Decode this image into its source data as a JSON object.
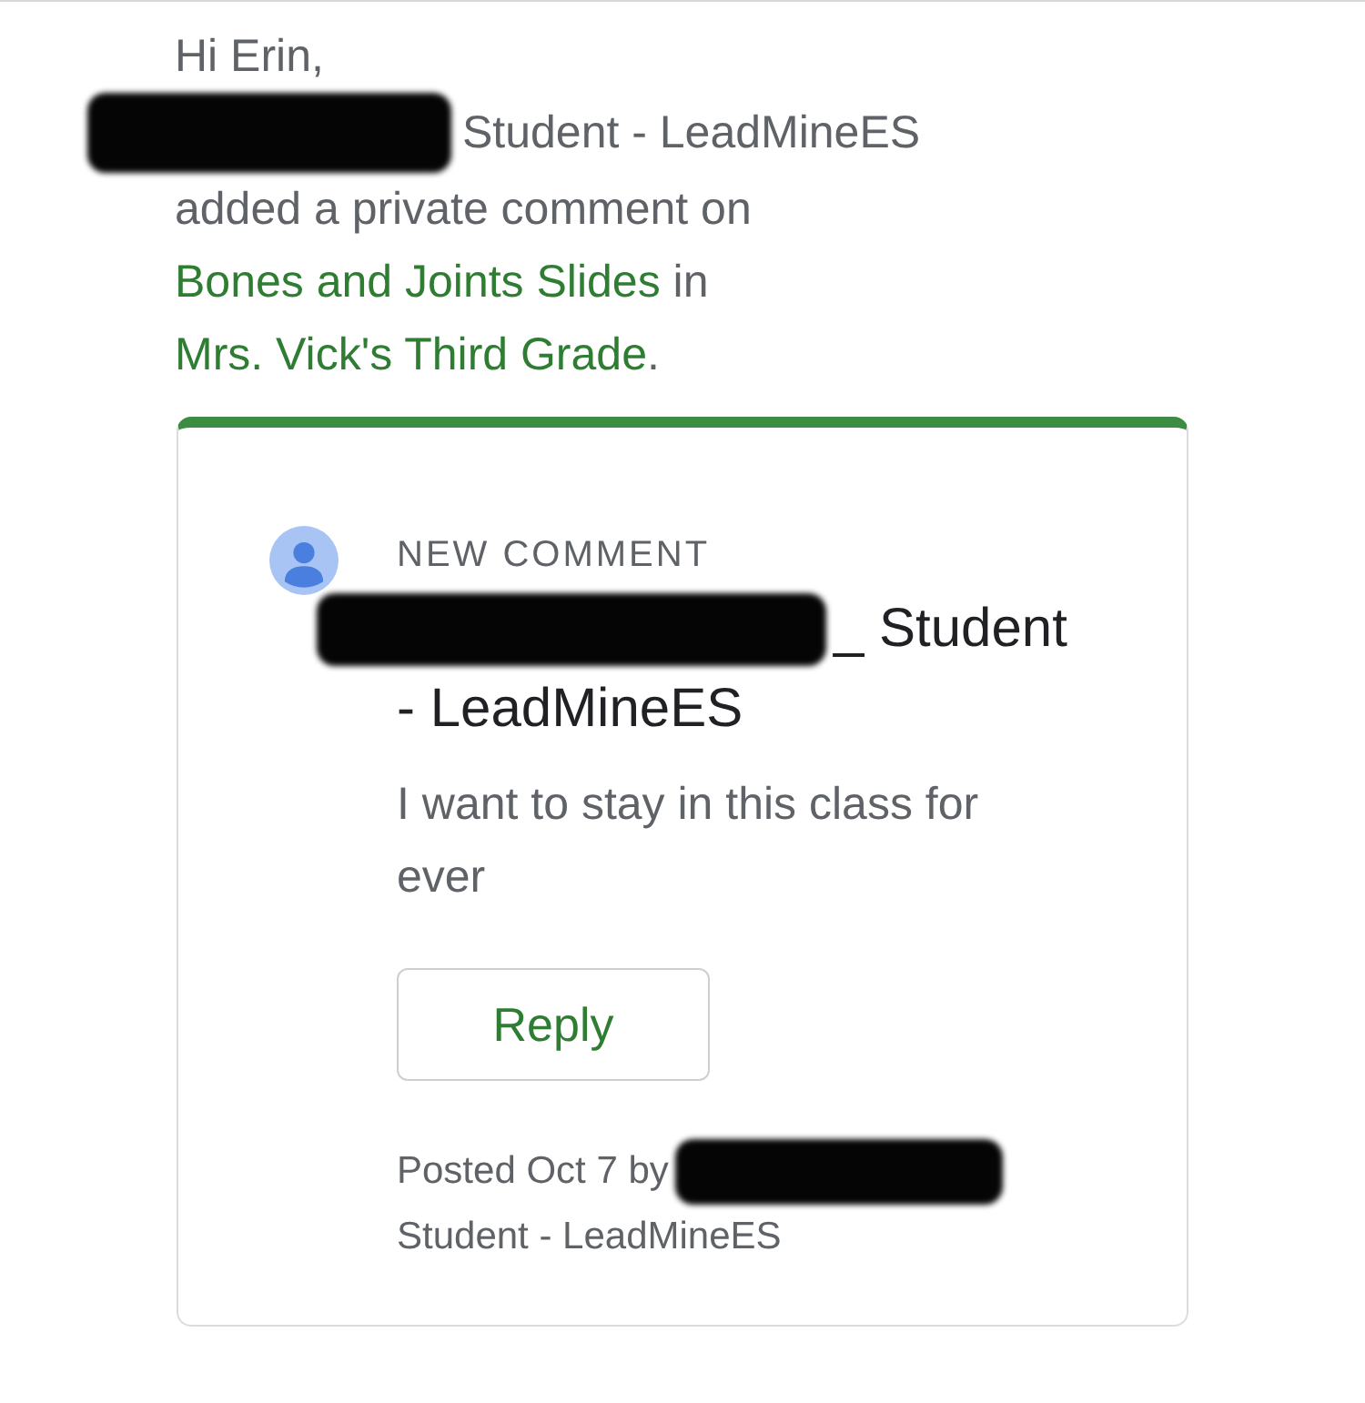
{
  "greeting": "Hi Erin,",
  "sender_suffix": "Student - LeadMineES",
  "notification": {
    "text": "added a private comment on",
    "assignment_link": "Bones and Joints Slides",
    "joiner": "in",
    "class_link": "Mrs. Vick's Third Grade",
    "end": "."
  },
  "comment_card": {
    "label": "NEW COMMENT",
    "author_suffix": "_ Student",
    "author_school": "- LeadMineES",
    "body": "I want to stay in this class for ever",
    "reply_button": "Reply",
    "posted": "Posted Oct 7 by",
    "posted_suffix": "Student - LeadMineES"
  }
}
